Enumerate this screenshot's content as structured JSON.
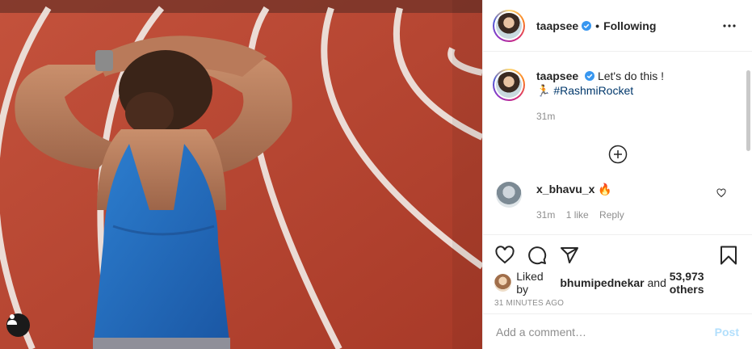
{
  "post": {
    "username": "taapsee",
    "follow_status": "Following",
    "separator": "•"
  },
  "caption": {
    "username": "taapsee",
    "text": "Let's do this !",
    "emoji": "🏃",
    "hashtag": "#RashmiRocket",
    "time": "31m"
  },
  "comments": [
    {
      "username": "x_bhavu_x",
      "text": "🔥",
      "time": "31m",
      "likes": "1 like",
      "reply_label": "Reply"
    }
  ],
  "likes": {
    "prefix": "Liked by",
    "first_user": "bhumipednekar",
    "middle": "and",
    "count": "53,973 others"
  },
  "timestamp": "31 MINUTES AGO",
  "add_comment": {
    "placeholder": "Add a comment…",
    "post_label": "Post"
  },
  "icons": {
    "verified": "verified-badge-icon",
    "more": "more-options-icon",
    "load_more": "plus-circle-icon",
    "like": "heart-icon",
    "comment": "comment-icon",
    "share": "share-icon",
    "save": "bookmark-icon",
    "user_tag": "user-tag-icon"
  },
  "colors": {
    "verified": "#3897f0",
    "hashtag": "#00376b",
    "post_disabled": "#b2dffc",
    "track": "#b8412f"
  }
}
